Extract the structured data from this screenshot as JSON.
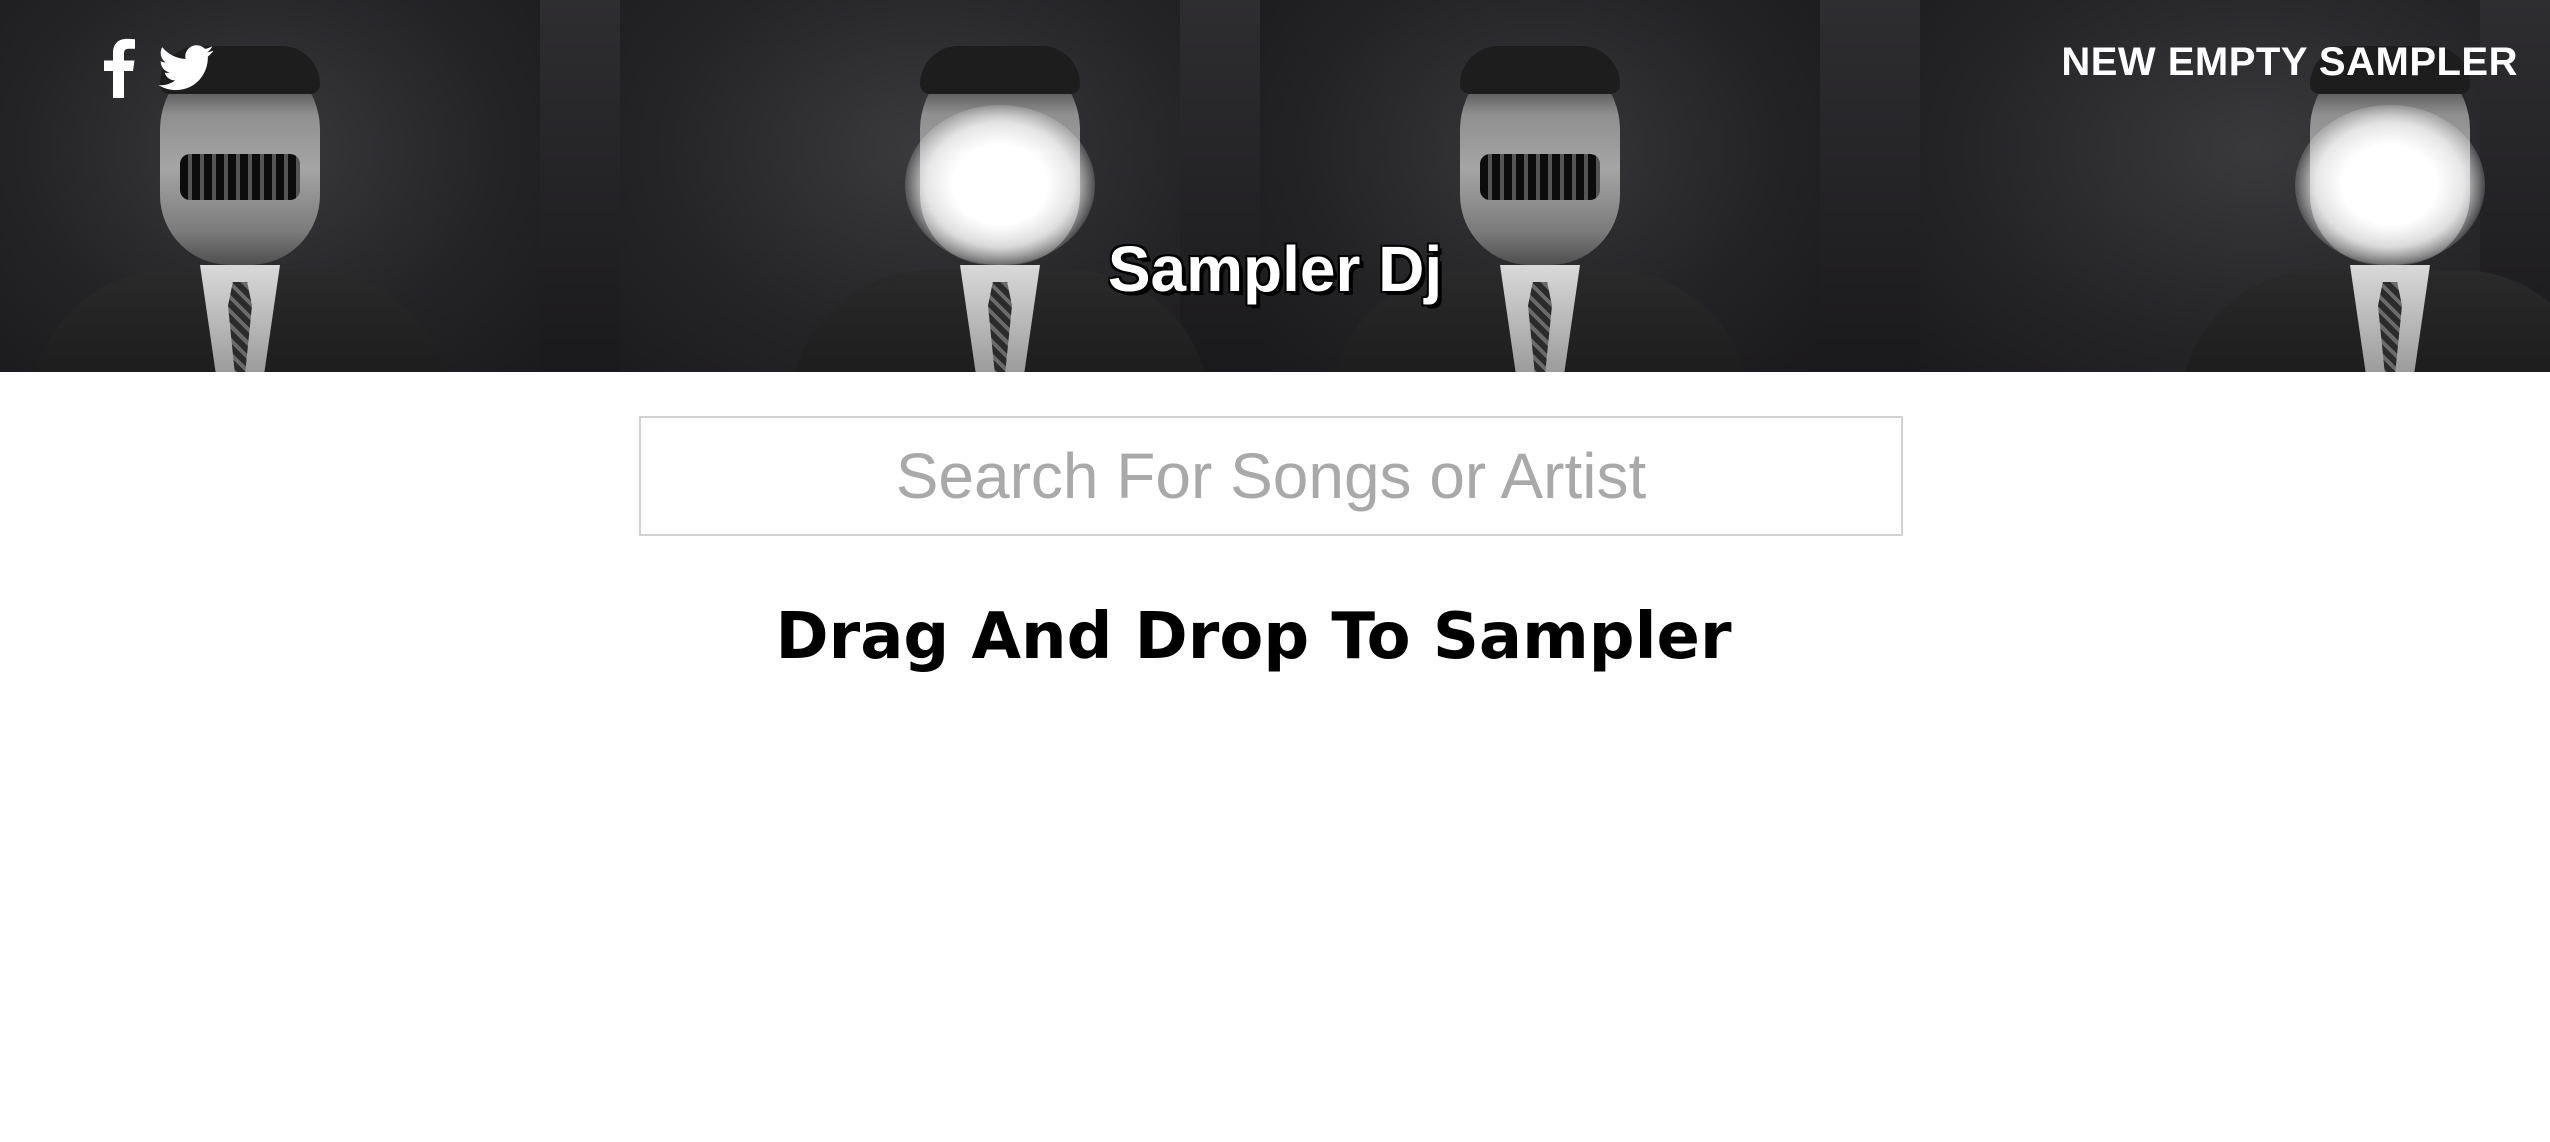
{
  "header": {
    "title": "Sampler Dj",
    "new_sampler_label": "NEW EMPTY SAMPLER",
    "social": [
      {
        "icon": "facebook-icon"
      },
      {
        "icon": "twitter-icon"
      }
    ]
  },
  "search": {
    "placeholder": "Search For Songs or Artist",
    "value": ""
  },
  "main": {
    "drop_heading": "Drag And Drop To Sampler"
  },
  "colors": {
    "header_text": "#ffffff",
    "body_background": "#ffffff",
    "search_border": "#d2d2d2",
    "placeholder": "#a9a9a9",
    "heading": "#000000"
  }
}
